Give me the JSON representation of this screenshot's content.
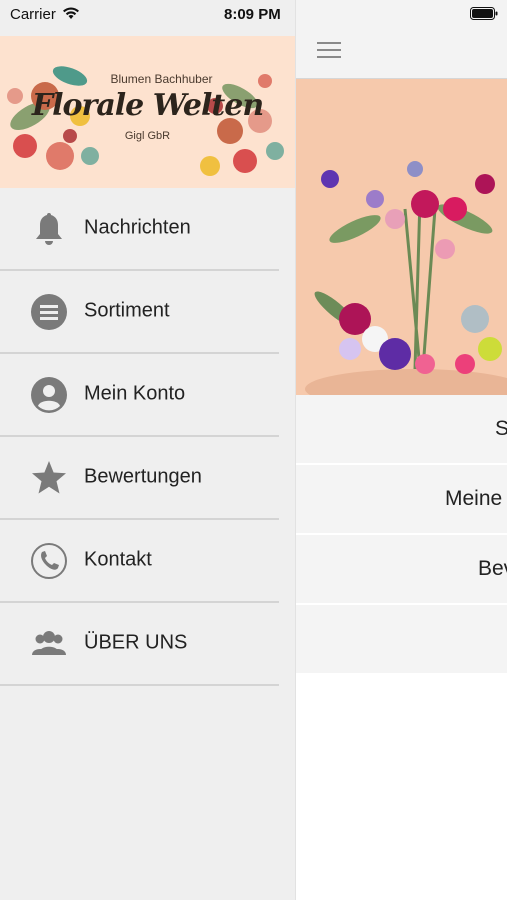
{
  "status_bar": {
    "carrier": "Carrier",
    "time": "8:09 PM"
  },
  "drawer": {
    "logo": {
      "top": "Blumen Bachhuber",
      "main": "Florale Welten",
      "bottom": "Gigl GbR"
    },
    "items": [
      {
        "label": "Nachrichten",
        "icon": "bell-icon"
      },
      {
        "label": "Sortiment",
        "icon": "list-icon"
      },
      {
        "label": "Mein Konto",
        "icon": "user-icon"
      },
      {
        "label": "Bewertungen",
        "icon": "star-icon"
      },
      {
        "label": "Kontakt",
        "icon": "phone-icon"
      },
      {
        "label": "ÜBER UNS",
        "icon": "group-icon"
      }
    ]
  },
  "main": {
    "rows": [
      {
        "label": "S"
      },
      {
        "label": "Meine"
      },
      {
        "label": "Bev"
      }
    ]
  },
  "colors": {
    "drawer_bg": "#efefef",
    "header_bg": "#fde2cf",
    "icon_gray": "#7a7a7a"
  }
}
